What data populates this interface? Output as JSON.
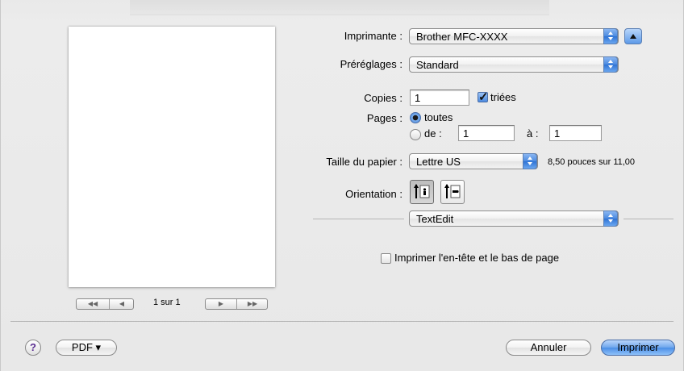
{
  "printer": {
    "label": "Imprimante :",
    "value": "Brother MFC-XXXX"
  },
  "presets": {
    "label": "Préréglages :",
    "value": "Standard"
  },
  "copies": {
    "label": "Copies :",
    "value": "1",
    "collated_label": "triées",
    "collated": true
  },
  "pages": {
    "label": "Pages :",
    "all_label": "toutes",
    "from_label": "de :",
    "from_value": "1",
    "to_label": "à :",
    "to_value": "1",
    "selected": "all"
  },
  "paper": {
    "label": "Taille du papier :",
    "value": "Lettre US",
    "dimensions": "8,50 pouces sur 11,00"
  },
  "orientation": {
    "label": "Orientation :",
    "selected": "portrait"
  },
  "section": {
    "value": "TextEdit"
  },
  "header_footer": {
    "label": "Imprimer l'en-tête et le bas de page",
    "checked": false
  },
  "preview": {
    "page_indicator": "1 sur 1"
  },
  "footer": {
    "help": "?",
    "pdf_label": "PDF ▾",
    "cancel_label": "Annuler",
    "print_label": "Imprimer"
  },
  "icons": {
    "disclosure": "disclosure-triangle-icon",
    "first": "first-page-icon",
    "prev": "previous-page-icon",
    "next": "next-page-icon",
    "last": "last-page-icon",
    "portrait": "portrait-orientation-icon",
    "landscape": "landscape-orientation-icon"
  },
  "colors": {
    "accent_blue": "#4a8ee6",
    "dialog_bg": "#e9e9e9"
  }
}
